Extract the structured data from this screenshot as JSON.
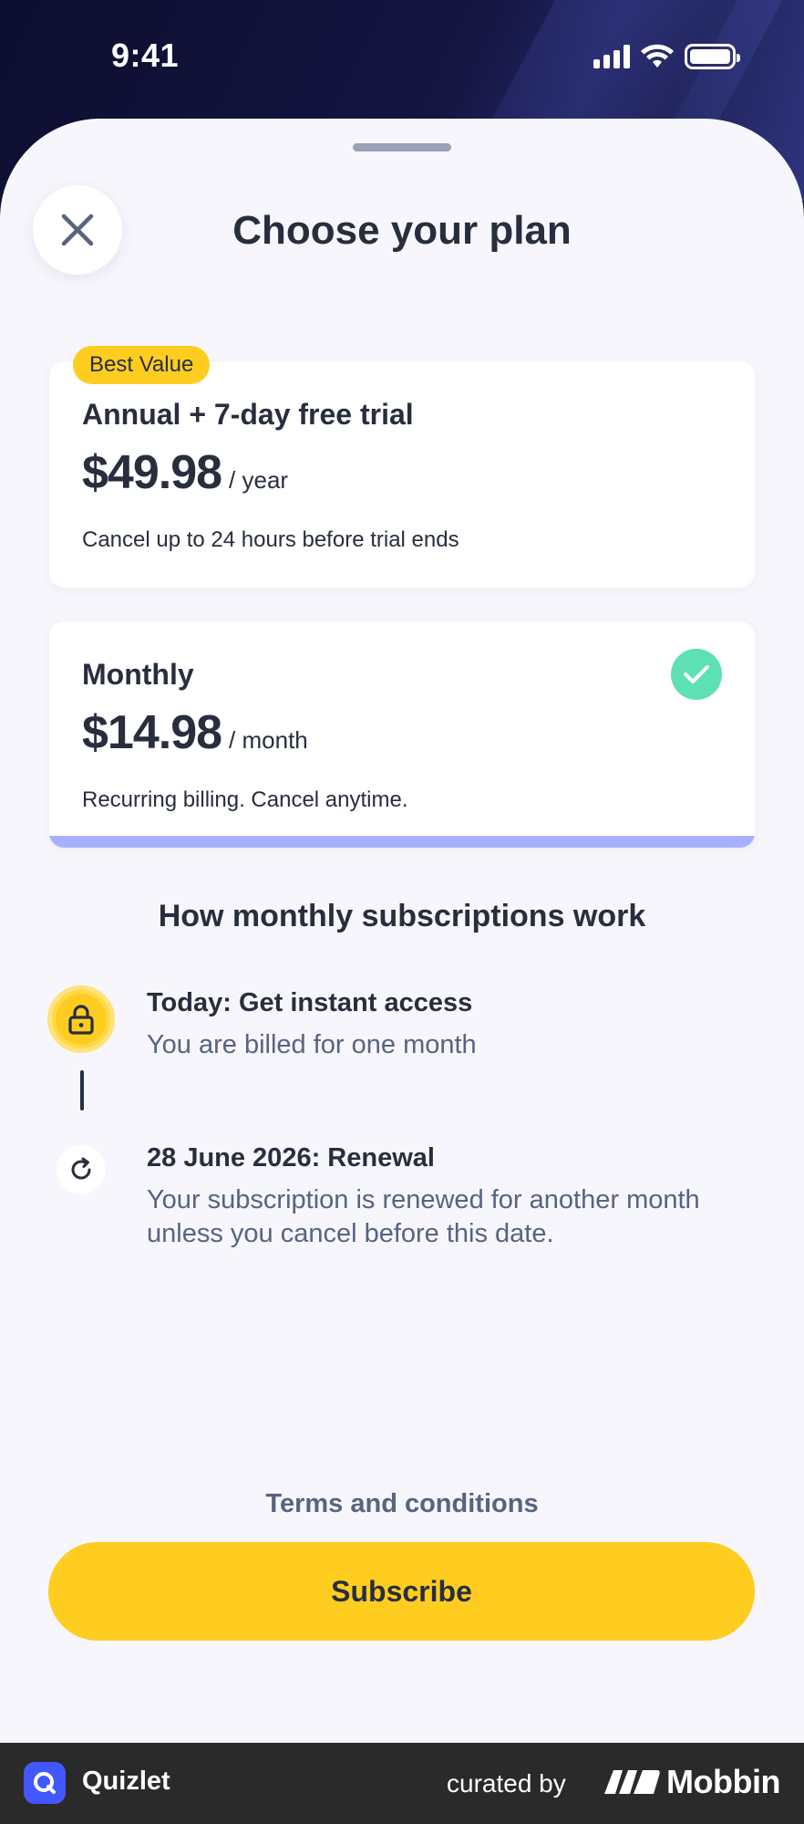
{
  "status_bar": {
    "time": "9:41"
  },
  "header": {
    "title": "Choose your plan"
  },
  "plans": [
    {
      "badge": "Best Value",
      "name": "Annual + 7-day free trial",
      "price": "$49.98",
      "period": "/ year",
      "note": "Cancel up to 24 hours before trial ends",
      "selected": false
    },
    {
      "name": "Monthly",
      "price": "$14.98",
      "period": "/ month",
      "note": "Recurring billing. Cancel anytime.",
      "selected": true
    }
  ],
  "how_it_works": {
    "title": "How monthly subscriptions work",
    "steps": [
      {
        "icon": "lock-icon",
        "title": "Today: Get instant access",
        "desc": "You are billed for one month"
      },
      {
        "icon": "renew-icon",
        "title": "28 June 2026: Renewal",
        "desc": "Your subscription is renewed for another month unless you cancel before this date."
      }
    ]
  },
  "footer_actions": {
    "terms": "Terms and conditions",
    "subscribe": "Subscribe"
  },
  "attribution": {
    "app_name": "Quizlet",
    "curated_by": "curated by",
    "brand": "Mobbin"
  },
  "colors": {
    "accent_yellow": "#ffcd1f",
    "check_green": "#5ce0b4",
    "selected_bar": "#a8b1ff",
    "text_dark": "#282e3e",
    "text_muted": "#586380"
  }
}
